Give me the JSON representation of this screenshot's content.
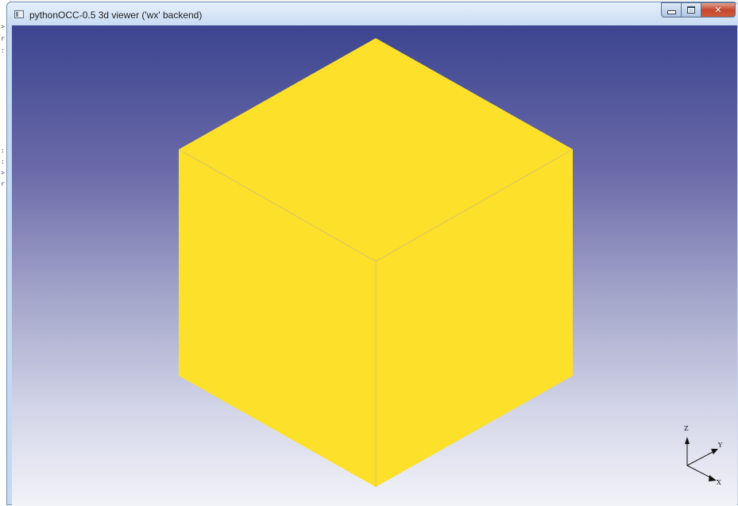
{
  "window": {
    "title": "pythonOCC-0.5 3d viewer ('wx' backend)",
    "controls": {
      "minimize": "minimize",
      "maximize": "maximize",
      "close": "close"
    }
  },
  "viewer": {
    "background_top": "#3c4590",
    "background_bottom": "#f2f3f8",
    "shape": "box",
    "shape_color": "#fde02a",
    "edge_color": "#d9c46a"
  },
  "triedron": {
    "z_label": "Z",
    "y_label": "Y",
    "x_label": "X"
  }
}
